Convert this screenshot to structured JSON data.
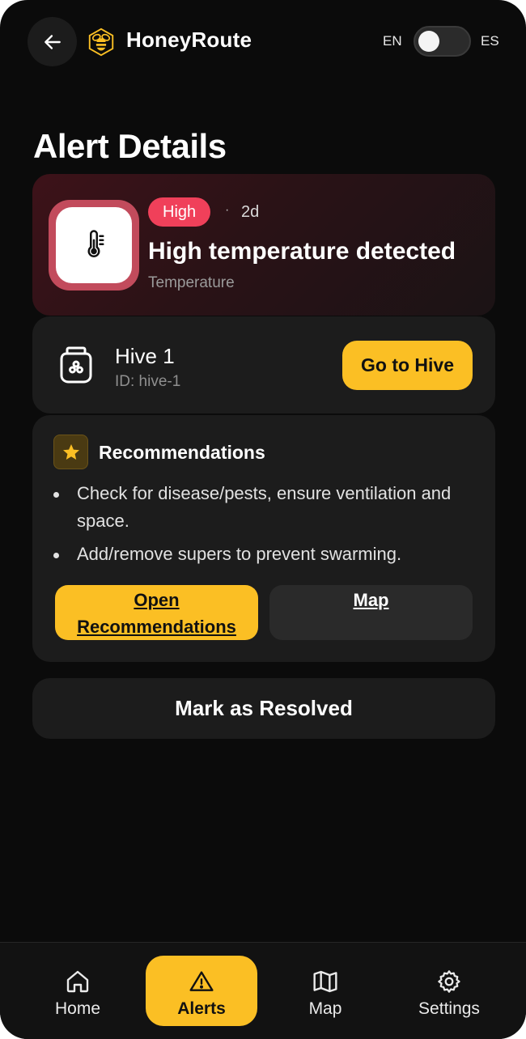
{
  "app": {
    "title": "HoneyRoute"
  },
  "language": {
    "left": "EN",
    "right": "ES",
    "active": "EN"
  },
  "page": {
    "title": "Alert Details"
  },
  "alert": {
    "severity": "High",
    "separator": "·",
    "age": "2d",
    "title": "High temperature detected",
    "category": "Temperature",
    "icon": "thermometer-icon"
  },
  "hive": {
    "name": "Hive 1",
    "id": "ID: hive-1",
    "go_label": "Go to Hive"
  },
  "recommendations": {
    "title": "Recommendations",
    "items": [
      "Check for disease/pests, ensure ventilation and space.",
      "Add/remove supers to prevent swarming."
    ],
    "open_label": "Open Recommendations",
    "map_label": "Map"
  },
  "actions": {
    "resolve_label": "Mark as Resolved"
  },
  "nav": {
    "items": [
      {
        "label": "Home",
        "icon": "home-icon"
      },
      {
        "label": "Alerts",
        "icon": "alert-triangle-icon"
      },
      {
        "label": "Map",
        "icon": "map-icon"
      },
      {
        "label": "Settings",
        "icon": "gear-icon"
      }
    ],
    "active": "Alerts"
  },
  "colors": {
    "accent": "#fbbf24",
    "severity_high": "#f0405a",
    "background": "#0b0b0b",
    "card": "#1c1c1c"
  }
}
